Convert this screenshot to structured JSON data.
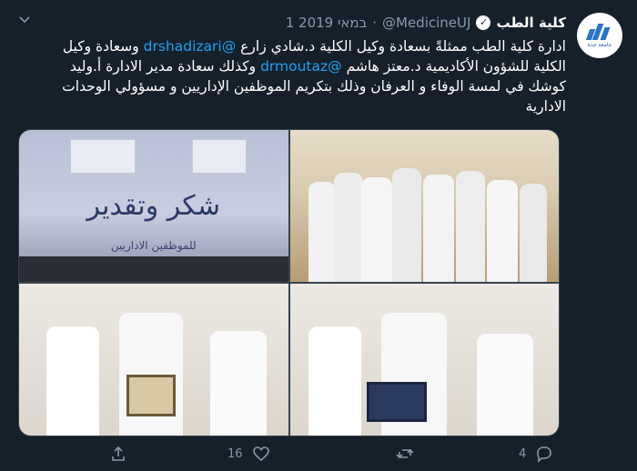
{
  "tweet": {
    "display_name": "كلية الطب",
    "handle": "@MedicineUJ",
    "dot": "·",
    "date": "1 במאי 2019",
    "avatar_text": "جامعة جدة",
    "text_parts": [
      "ادارة كلية الطب ممثلةً بسعادة وكيل الكلية د.شادي زارع ",
      "@drshadizari",
      " وسعادة وكيل الكلية للشؤون الأكاديمية د.معتز هاشم ",
      "@drmoutaz",
      " وكذلك سعادة مدير الادارة أ.وليد كوشك في لمسة الوفاء و العرفان وذلك بتكريم الموظفين الإداريين و مسؤولي الوحدات الادارية"
    ]
  },
  "media": {
    "slide_title": "شكر وتقدير",
    "slide_subtitle": "للموظفين الاداريين"
  },
  "actions": {
    "reply_count": "4",
    "retweet_count": "",
    "like_count": "16"
  },
  "colors": {
    "background": "#15202b",
    "accent": "#1da1f2",
    "muted": "#8899a6"
  }
}
